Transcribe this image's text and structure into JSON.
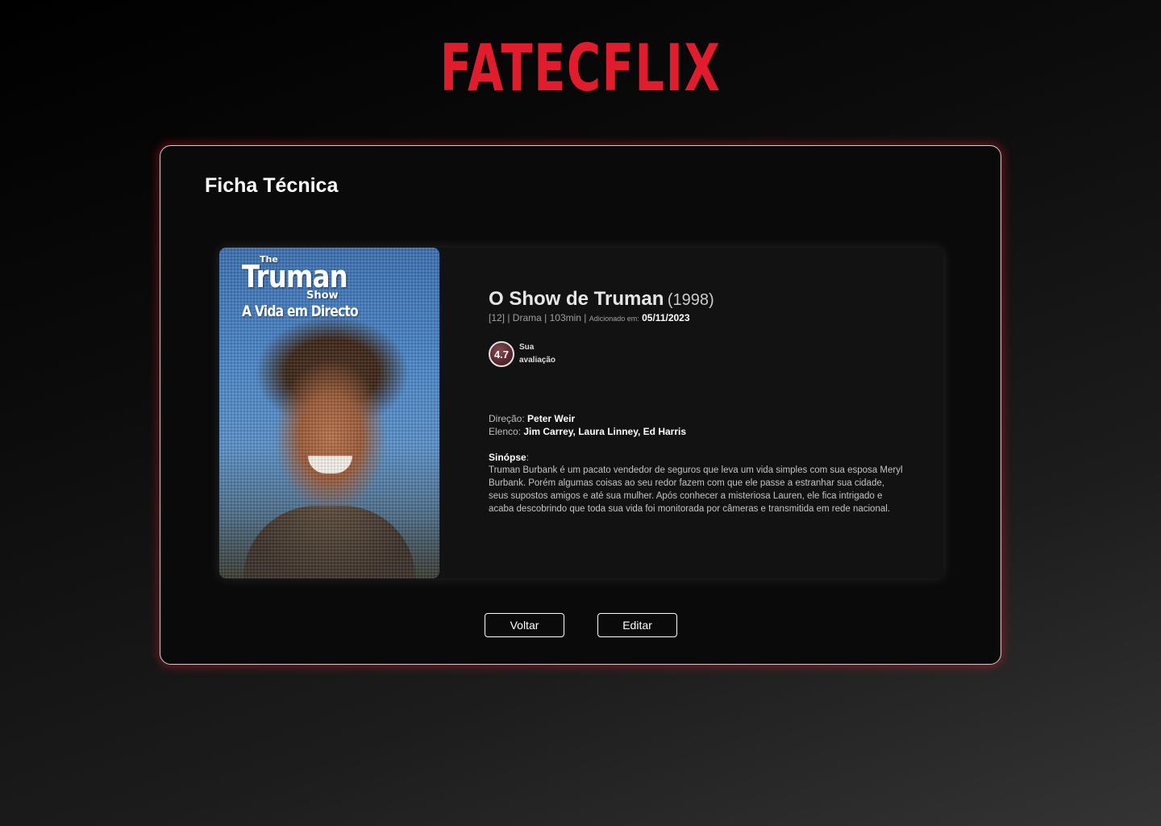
{
  "brand": {
    "logo_text": "FATECFLIX",
    "accent_color": "#e11d2d"
  },
  "panel": {
    "title": "Ficha Técnica"
  },
  "movie": {
    "poster": {
      "line_the": "The",
      "line_title": "Truman",
      "line_show": "Show",
      "line_subtitle": "A Vida em Directo"
    },
    "title": "O Show de Truman",
    "year": "(1998)",
    "meta_prefix": "[12] | Drama | 103min | ",
    "added_label": "Adicionado em:",
    "added_date": "05/11/2023",
    "rating_value": "4.7",
    "rating_label": "Sua avaliação",
    "direction_label": "Direção:",
    "direction_value": "Peter Weir",
    "cast_label": "Elenco:",
    "cast_value": "Jim Carrey, Laura Linney, Ed Harris",
    "synopsis_label": "Sinópse",
    "synopsis_text": "Truman Burbank é um pacato vendedor de seguros que leva um vida simples com sua esposa Meryl Burbank. Porém algumas coisas ao seu redor fazem com que ele passe a estranhar sua cidade, seus supostos amigos e até sua mulher. Após conhecer a misteriosa Lauren, ele fica intrigado e acaba descobrindo que toda sua vida foi monitorada por câmeras e transmitida em rede nacional."
  },
  "actions": {
    "back_label": "Voltar",
    "edit_label": "Editar"
  }
}
